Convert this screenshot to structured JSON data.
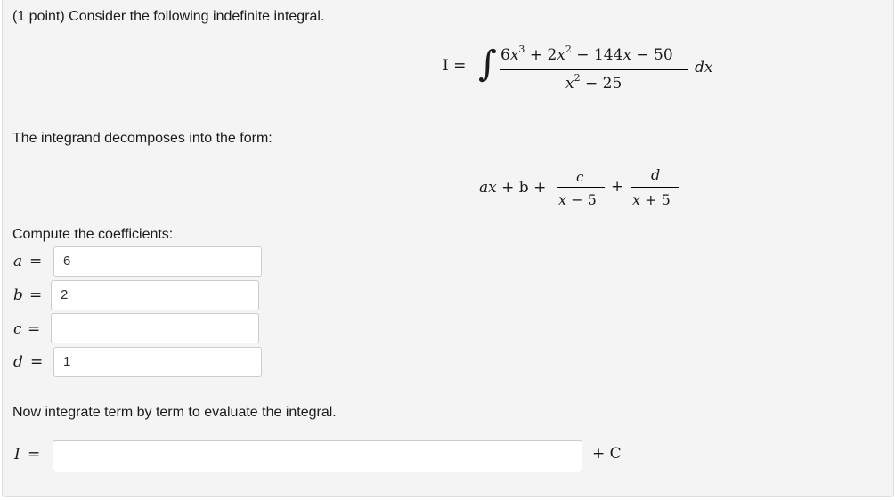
{
  "problem": {
    "intro": "(1 point) Consider the following indefinite integral.",
    "decompose_text": "The integrand decomposes into the form:",
    "compute_text": "Compute the coefficients:",
    "integrate_text": "Now integrate term by term to evaluate the integral."
  },
  "integral": {
    "lhs": "I =",
    "num": {
      "c1": "6",
      "v1": "x",
      "e1": "3",
      "op1": "+ 2",
      "v2": "x",
      "e2": "2",
      "op2": "− 144",
      "v3": "x",
      "op3": "− 50"
    },
    "den": {
      "v": "x",
      "e": "2",
      "rest": "− 25"
    },
    "dx": "dx"
  },
  "form": {
    "a": "a",
    "x": "x",
    "plus_b": "+ b +",
    "c": "c",
    "d": "d",
    "plus": "+",
    "den1": "x",
    "den1_rest": "− 5",
    "den2": "x",
    "den2_rest": "+ 5"
  },
  "coefficients": [
    {
      "var": "a",
      "eq": "=",
      "value": "6"
    },
    {
      "var": "b",
      "eq": "=",
      "value": "2"
    },
    {
      "var": "c",
      "eq": "=",
      "value": ""
    },
    {
      "var": "d",
      "eq": "=",
      "value": "1"
    }
  ],
  "answer": {
    "var": "I",
    "eq": "=",
    "value": "",
    "suffix": "+ C"
  }
}
